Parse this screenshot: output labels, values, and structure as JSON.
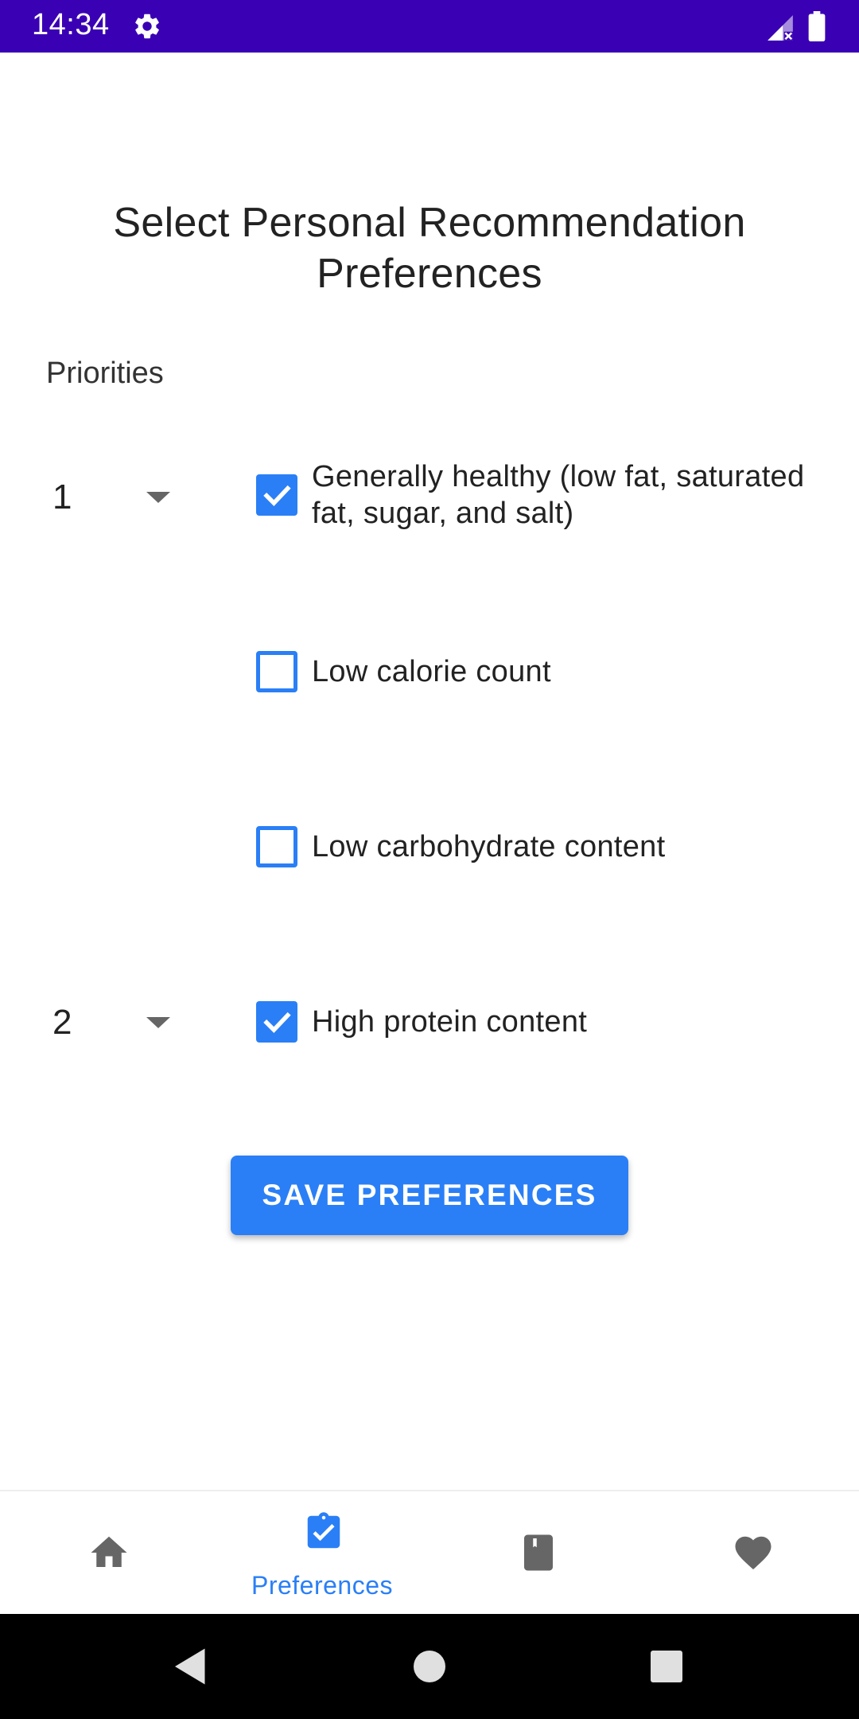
{
  "colors": {
    "status_bar": "#3a00b4",
    "accent": "#2a7ff6",
    "icon_inactive": "#666666",
    "text": "#222222"
  },
  "status_bar": {
    "time": "14:34",
    "icons": [
      "settings-gear-icon",
      "signal-icon",
      "battery-icon"
    ]
  },
  "page": {
    "title": "Select Personal Recommendation Preferences",
    "section_label": "Priorities"
  },
  "preferences": [
    {
      "label": "Generally healthy (low fat, saturated fat, sugar, and salt)",
      "checked": true,
      "priority": "1"
    },
    {
      "label": "Low calorie count",
      "checked": false,
      "priority": ""
    },
    {
      "label": "Low carbohydrate content",
      "checked": false,
      "priority": ""
    },
    {
      "label": "High protein content",
      "checked": true,
      "priority": "2"
    }
  ],
  "save_button": {
    "label": "SAVE PREFERENCES"
  },
  "bottom_nav": {
    "items": [
      {
        "icon": "home-icon",
        "label": "",
        "active": false
      },
      {
        "icon": "clipboard-check-icon",
        "label": "Preferences",
        "active": true
      },
      {
        "icon": "book-icon",
        "label": "",
        "active": false
      },
      {
        "icon": "heart-icon",
        "label": "",
        "active": false
      }
    ]
  },
  "system_nav": {
    "icons": [
      "back-icon",
      "home-circle-icon",
      "recents-icon"
    ]
  }
}
